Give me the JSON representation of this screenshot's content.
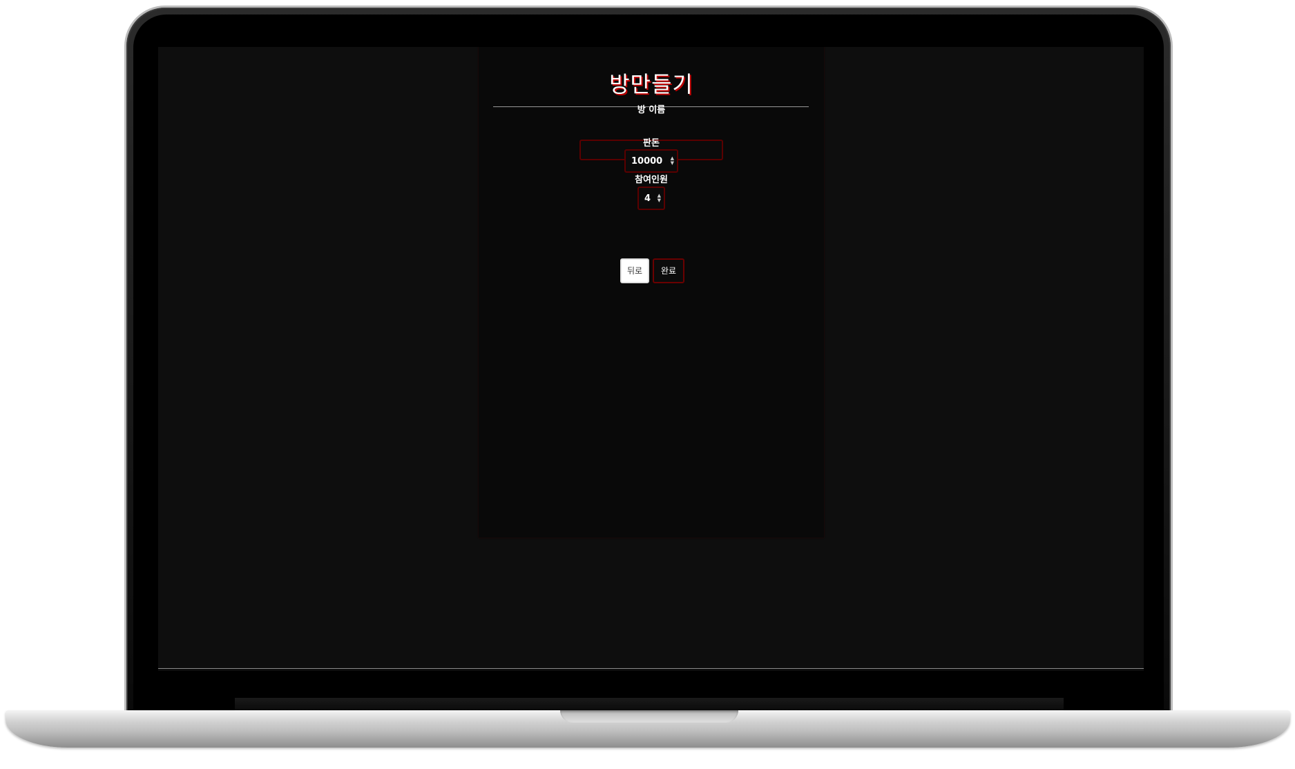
{
  "modal": {
    "title": "방만들기",
    "room_name_label": "방 이름",
    "room_name_value": "",
    "stake_label": "판돈",
    "stake_value": "10000",
    "players_label": "참여인원",
    "players_value": "4",
    "back_label": "뒤로",
    "done_label": "완료"
  },
  "icons": {
    "stepper_arrows": "up-down-arrows-icon"
  },
  "colors": {
    "accent": "#c00000",
    "background": "#0e0e0e",
    "border": "#5a0000"
  }
}
